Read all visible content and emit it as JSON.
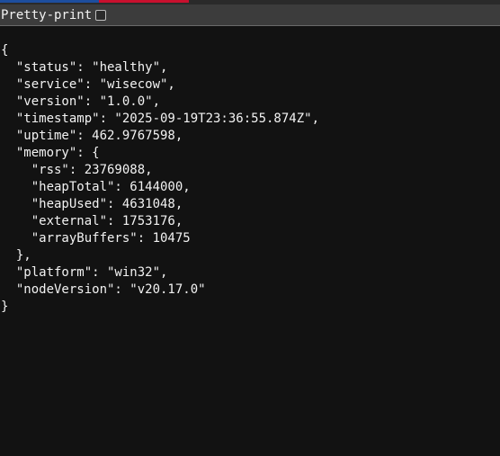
{
  "toolbar": {
    "pretty_print_label": "Pretty-print",
    "pretty_print_checked": false
  },
  "json_lines": [
    "{",
    "  \"status\": \"healthy\",",
    "  \"service\": \"wisecow\",",
    "  \"version\": \"1.0.0\",",
    "  \"timestamp\": \"2025-09-19T23:36:55.874Z\",",
    "  \"uptime\": 462.9767598,",
    "  \"memory\": {",
    "    \"rss\": 23769088,",
    "    \"heapTotal\": 6144000,",
    "    \"heapUsed\": 4631048,",
    "    \"external\": 1753176,",
    "    \"arrayBuffers\": 10475",
    "  },",
    "  \"platform\": \"win32\",",
    "  \"nodeVersion\": \"v20.17.0\"",
    "}"
  ],
  "colors": {
    "background": "#121212",
    "toolbar": "#3c3c3c",
    "text": "#f2f2f2"
  }
}
